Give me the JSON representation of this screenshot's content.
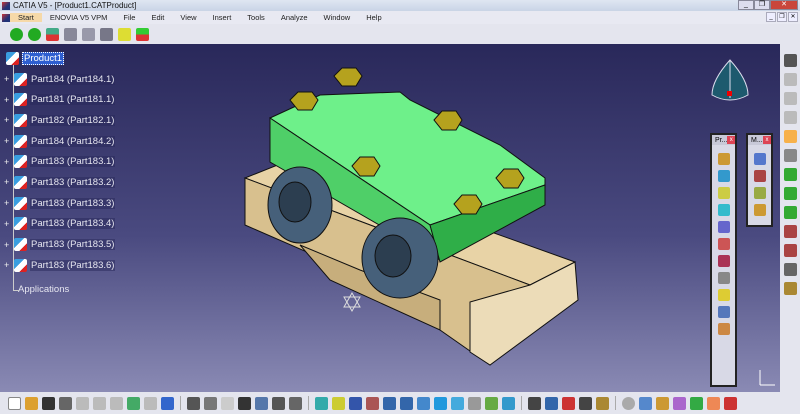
{
  "window": {
    "title": "CATIA V5 - [Product1.CATProduct]",
    "controls": [
      "minimize",
      "restore",
      "close"
    ]
  },
  "menu": [
    "Start",
    "ENOVIA V5 VPM",
    "File",
    "Edit",
    "View",
    "Insert",
    "Tools",
    "Analyze",
    "Window",
    "Help"
  ],
  "tree": {
    "root": "Product1",
    "children": [
      "Part184 (Part184.1)",
      "Part181 (Part181.1)",
      "Part182 (Part182.1)",
      "Part184 (Part184.2)",
      "Part183 (Part183.1)",
      "Part183 (Part183.2)",
      "Part183 (Part183.3)",
      "Part183 (Part183.4)",
      "Part183 (Part183.5)",
      "Part183 (Part183.6)"
    ],
    "applications": "Applications"
  },
  "panels": {
    "product": "Pr...",
    "move": "M..."
  },
  "colors": {
    "green": "#6ef08a",
    "tan": "#e8d3a6",
    "bolt": "#b5a21e",
    "roller": "#46607a",
    "bg_top": "#29285a",
    "bg_bottom": "#8a8ab4"
  }
}
